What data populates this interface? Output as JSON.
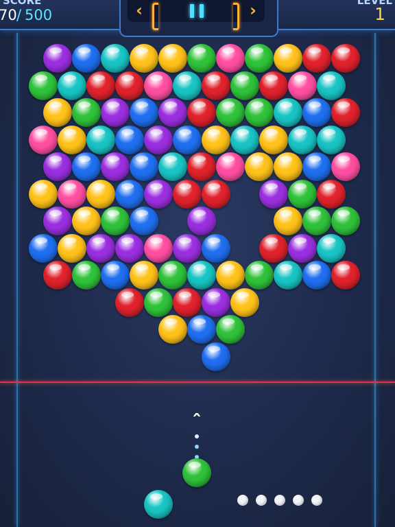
{
  "colors": {
    "purple": "#9b2fe0",
    "blue": "#1f6ff0",
    "cyan": "#19c4c4",
    "yellow": "#ffc21a",
    "green": "#2fc23a",
    "red": "#e0222c",
    "pink": "#ff4fa2",
    "white": "#f2f4f8"
  },
  "hud": {
    "score_label": "SCORE",
    "score_current": "70",
    "score_separator": "/",
    "score_target": "500",
    "level_label": "LEVEL",
    "level_value": "1",
    "prev_icon": "chevron-left-icon",
    "next_icon": "chevron-right-icon",
    "pause_icon": "pause-icon"
  },
  "board": {
    "rows": [
      {
        "offset": 1,
        "cells": [
          "purple",
          "blue",
          "cyan",
          "yellow",
          "yellow",
          "green",
          "pink",
          "green",
          "yellow",
          "red",
          "red"
        ]
      },
      {
        "offset": 0,
        "cells": [
          "green",
          "cyan",
          "red",
          "red",
          "pink",
          "cyan",
          "red",
          "green",
          "red",
          "pink",
          "cyan"
        ]
      },
      {
        "offset": 1,
        "cells": [
          "yellow",
          "green",
          "purple",
          "blue",
          "purple",
          "red",
          "green",
          "green",
          "cyan",
          "blue",
          "red"
        ]
      },
      {
        "offset": 0,
        "cells": [
          "pink",
          "yellow",
          "cyan",
          "blue",
          "purple",
          "blue",
          "yellow",
          "cyan",
          "yellow",
          "cyan",
          "cyan"
        ]
      },
      {
        "offset": 1,
        "cells": [
          "purple",
          "blue",
          "purple",
          "blue",
          "cyan",
          "red",
          "pink",
          "yellow",
          "yellow",
          "blue",
          "pink"
        ]
      },
      {
        "offset": 0,
        "cells": [
          "yellow",
          "pink",
          "yellow",
          "blue",
          "purple",
          "red",
          "red",
          null,
          "purple",
          "green",
          "red"
        ]
      },
      {
        "offset": 1,
        "cells": [
          "purple",
          "yellow",
          "green",
          "blue",
          null,
          "purple",
          null,
          null,
          "yellow",
          "green",
          "green"
        ]
      },
      {
        "offset": 0,
        "cells": [
          "blue",
          "yellow",
          "purple",
          "purple",
          "pink",
          "purple",
          "blue",
          null,
          "red",
          "purple",
          "cyan"
        ]
      },
      {
        "offset": 1,
        "cells": [
          "red",
          "green",
          "blue",
          "yellow",
          "green",
          "cyan",
          "yellow",
          "green",
          "cyan",
          "blue",
          "red"
        ]
      },
      {
        "offset": 0,
        "cells": [
          null,
          null,
          null,
          "red",
          "green",
          "red",
          "purple",
          "yellow",
          null,
          null,
          null
        ]
      },
      {
        "offset": 1,
        "cells": [
          null,
          null,
          null,
          null,
          "yellow",
          "blue",
          "green",
          null,
          null,
          null,
          null
        ]
      },
      {
        "offset": 0,
        "cells": [
          null,
          null,
          null,
          null,
          null,
          null,
          "blue",
          null,
          null,
          null,
          null
        ]
      }
    ]
  },
  "shooter": {
    "current": "green",
    "next": "cyan",
    "aim_icon": "chevron-up-icon",
    "shots_remaining": 5
  }
}
